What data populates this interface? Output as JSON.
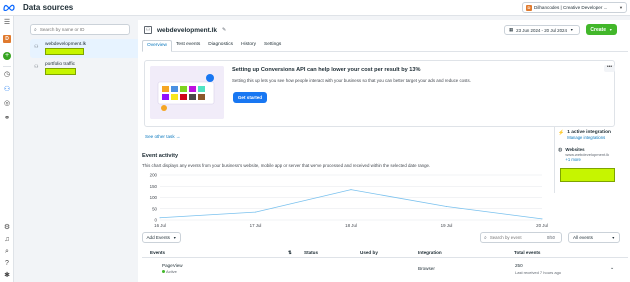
{
  "app": {
    "title": "Data sources"
  },
  "account": {
    "badge": "D",
    "label": "Dilhancodes | Creative Developer ..."
  },
  "rail": {
    "avatar": "D"
  },
  "sidebar": {
    "search_placeholder": "Search by name or ID",
    "items": [
      {
        "name": "webdevelopment.lk"
      },
      {
        "name": "portfolio traffic"
      }
    ]
  },
  "pixel": {
    "name": "webdevelopment.lk"
  },
  "date_range": "23 Jun 2024 - 20 Jul 2024",
  "create_label": "Create",
  "tabs": [
    {
      "label": "Overview"
    },
    {
      "label": "Test events"
    },
    {
      "label": "Diagnostics"
    },
    {
      "label": "History"
    },
    {
      "label": "Settings"
    }
  ],
  "promo": {
    "title": "Setting up Conversions API can help lower your cost per result by 13%",
    "subtitle": "Setting this up lets you see how people interact with your business so that you can better target your ads and reduce costs.",
    "cta": "Get started",
    "more": "•••"
  },
  "see_other": "See other task",
  "activity": {
    "title": "Event activity",
    "subtitle": "This chart displays any events from your business's website, mobile app or server that we've processed and received within the selected date range."
  },
  "chart_data": {
    "type": "line",
    "x": [
      "16 Jul",
      "17 Jul",
      "18 Jul",
      "19 Jul",
      "20 Jul"
    ],
    "y_ticks": [
      0,
      50,
      100,
      150,
      200
    ],
    "ylim": [
      0,
      200
    ],
    "series": [
      {
        "values": [
          10,
          35,
          135,
          60,
          5
        ]
      }
    ],
    "line_color": "#79c1ee"
  },
  "integration": {
    "count_label": "1 active integration",
    "manage_label": "Manage integrations",
    "source_name": "Websites",
    "source_url": "www.webdevelopment.lk",
    "more_label": "+1 more"
  },
  "events": {
    "add_label": "Add Events",
    "search_placeholder": "Search by event",
    "count": "0/50",
    "filter_label": "All events",
    "headers": [
      "Events",
      "Status",
      "Used by",
      "Integration",
      "Total events"
    ],
    "rows": [
      {
        "event": "PageView",
        "status": "Active",
        "used_by": "",
        "integration": "Browser",
        "total": "250",
        "last_received": "Last received 7 hours ago"
      }
    ]
  }
}
